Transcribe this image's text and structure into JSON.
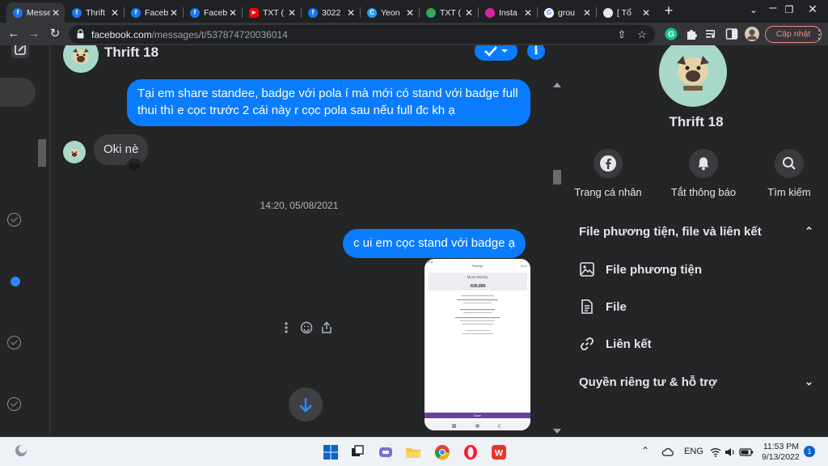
{
  "browser": {
    "tabs": [
      {
        "title": "Messe",
        "favicon": "facebook-icon",
        "color": "#1877f2",
        "active": true
      },
      {
        "title": "Thrift",
        "favicon": "facebook-icon",
        "color": "#1877f2"
      },
      {
        "title": "Faceb",
        "favicon": "facebook-icon",
        "color": "#1877f2"
      },
      {
        "title": "Faceb",
        "favicon": "facebook-icon",
        "color": "#1877f2"
      },
      {
        "title": "TXT (",
        "favicon": "youtube-icon",
        "color": "#ff0000"
      },
      {
        "title": "3022",
        "favicon": "facebook-icon",
        "color": "#1877f2"
      },
      {
        "title": "Yeon",
        "favicon": "c-logo-icon",
        "color": "#1da1f2"
      },
      {
        "title": "TXT (",
        "favicon": "google-drive-icon",
        "color": "#34a853"
      },
      {
        "title": "Insta",
        "favicon": "instagram-icon",
        "color": "#d6249f"
      },
      {
        "title": "grou",
        "favicon": "google-icon",
        "color": "#ffffff"
      },
      {
        "title": "[ Tổ",
        "favicon": "web-icon",
        "color": "#e8eaed"
      }
    ],
    "url_host": "facebook.com",
    "url_path": "/messages/t/537874720036014",
    "update_label": "Cập nhật"
  },
  "chat": {
    "name": "Thrift 18",
    "messages": {
      "out_1": "Tại em share standee, badge với pola í mà mới có stand với badge full thui thì e cọc trước  2 cái này r cọc pola sau nếu full đc kh ạ",
      "in_1": "Oki nè",
      "out_2": "c ui em cọc stand với badge ạ"
    },
    "timestamp": "14:20, 05/08/2021",
    "attachment": {
      "header": "Receipt",
      "close": "Done",
      "title": "Move Money",
      "amount": "-530,000",
      "button": "Done"
    }
  },
  "info_panel": {
    "name": "Thrift 18",
    "actions": [
      {
        "label": "Trang cá nhân",
        "icon": "facebook-icon"
      },
      {
        "label": "Tắt thông báo",
        "icon": "bell-icon"
      },
      {
        "label": "Tìm kiếm",
        "icon": "search-icon"
      }
    ],
    "section_title": "File phương tiện, file và liên kết",
    "items": [
      "File phương tiện",
      "File",
      "Liên kết"
    ],
    "privacy_title": "Quyền riêng tư & hỗ trợ"
  },
  "taskbar": {
    "language": "ENG",
    "time": "11:53 PM",
    "date": "9/13/2022",
    "notifications": "1"
  }
}
